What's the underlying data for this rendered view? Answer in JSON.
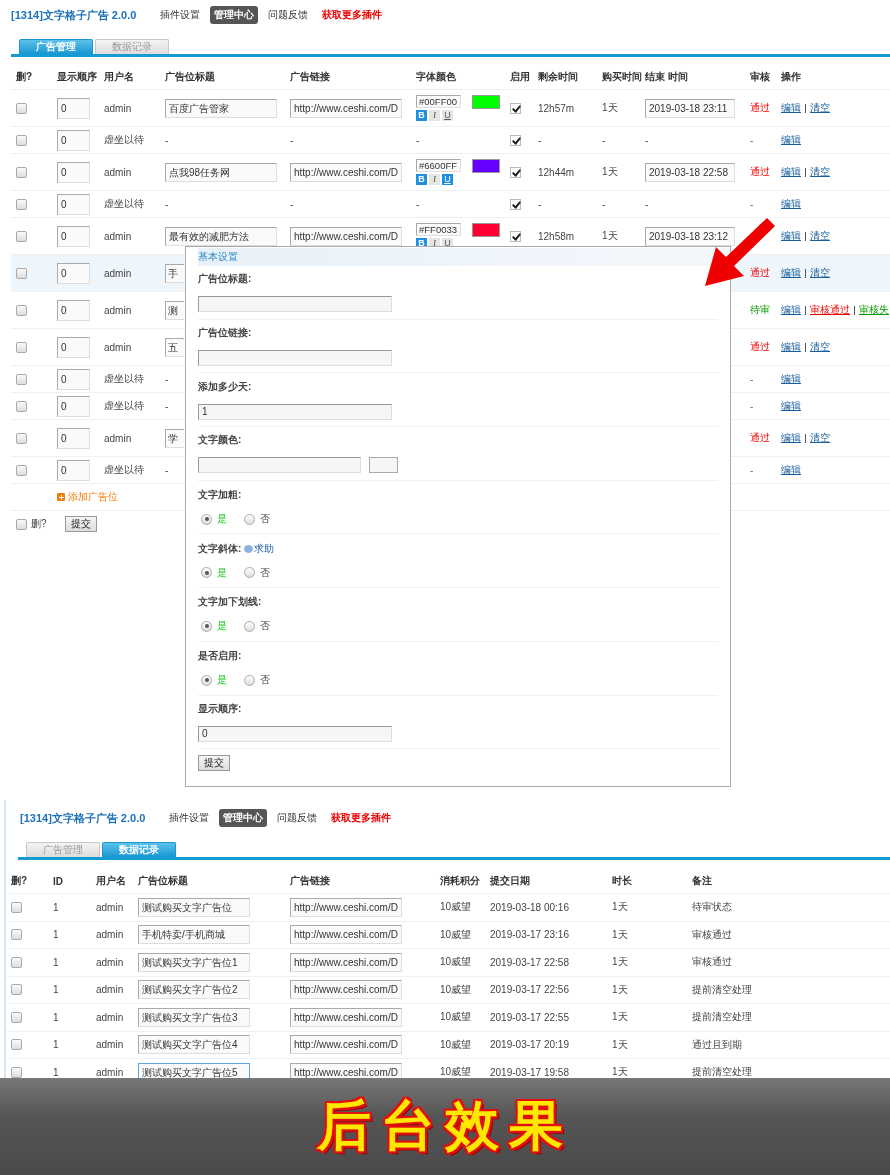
{
  "top": {
    "header": {
      "title": "[1314]文字格子广告 2.0.0",
      "nav": [
        {
          "label": "插件设置",
          "selected": false,
          "kind": "plain"
        },
        {
          "label": "管理中心",
          "selected": true,
          "kind": "plain"
        },
        {
          "label": "问题反馈",
          "selected": false,
          "kind": "plain"
        },
        {
          "label": "获取更多插件",
          "selected": false,
          "kind": "promo"
        }
      ]
    },
    "tabs": [
      {
        "label": "广告管理",
        "selected": true
      },
      {
        "label": "数据记录",
        "selected": false
      }
    ],
    "table": {
      "columns": [
        "删?",
        "显示顺序",
        "用户名",
        "广告位标题",
        "广告链接",
        "字体颜色",
        "启用",
        "剩余时间",
        "购买时间",
        "结束 时间",
        "审核",
        "操作"
      ],
      "rows": [
        {
          "kind": "ad",
          "selected": false,
          "delete": false,
          "order": "0",
          "user": "admin",
          "title": "百度广告管家",
          "link": "http://www.ceshi.com/D",
          "font_color": {
            "hex": "#00FF00",
            "format": [
              {
                "label": "B",
                "on": true
              },
              {
                "label": "I",
                "on": false
              },
              {
                "label": "U",
                "on": false
              }
            ]
          },
          "enabled": true,
          "remaining": "12h57m",
          "bought": "1天",
          "end": "2019-03-18 23:11",
          "status": {
            "text": "通过",
            "kind": "pass"
          },
          "actions": [
            {
              "label": "编辑",
              "kind": "edit"
            },
            {
              "label": "清空",
              "kind": "clear"
            }
          ]
        },
        {
          "kind": "vacant",
          "selected": false,
          "delete": false,
          "order": "0",
          "user": "虚坐以待",
          "title": "-",
          "link": "-",
          "font_color_text": "-",
          "enabled": true,
          "remaining": "-",
          "bought": "-",
          "end": "-",
          "status": {
            "text": "-",
            "kind": "none"
          },
          "actions": [
            {
              "label": "编辑",
              "kind": "edit"
            }
          ]
        },
        {
          "kind": "ad",
          "selected": false,
          "delete": false,
          "order": "0",
          "user": "admin",
          "title": "点我98任务网",
          "link": "http://www.ceshi.com/D",
          "font_color": {
            "hex": "#6600FF",
            "format": [
              {
                "label": "B",
                "on": true
              },
              {
                "label": "I",
                "on": false
              },
              {
                "label": "U",
                "on": true
              }
            ]
          },
          "enabled": true,
          "remaining": "12h44m",
          "bought": "1天",
          "end": "2019-03-18 22:58",
          "status": {
            "text": "通过",
            "kind": "pass"
          },
          "actions": [
            {
              "label": "编辑",
              "kind": "edit"
            },
            {
              "label": "清空",
              "kind": "clear"
            }
          ]
        },
        {
          "kind": "vacant",
          "selected": false,
          "delete": false,
          "order": "0",
          "user": "虚坐以待",
          "title": "-",
          "link": "-",
          "font_color_text": "-",
          "enabled": true,
          "remaining": "-",
          "bought": "-",
          "end": "-",
          "status": {
            "text": "-",
            "kind": "none"
          },
          "actions": [
            {
              "label": "编辑",
              "kind": "edit"
            }
          ]
        },
        {
          "kind": "ad",
          "selected": false,
          "delete": false,
          "order": "0",
          "user": "admin",
          "title": "最有效的减肥方法",
          "link": "http://www.ceshi.com/D",
          "font_color": {
            "hex": "#FF0033",
            "format": [
              {
                "label": "B",
                "on": true
              },
              {
                "label": "I",
                "on": false
              },
              {
                "label": "U",
                "on": false
              }
            ]
          },
          "enabled": true,
          "remaining": "12h58m",
          "bought": "1天",
          "end": "2019-03-18 23:12",
          "actions": [
            {
              "label": "编辑",
              "kind": "edit"
            },
            {
              "label": "清空",
              "kind": "clear"
            }
          ]
        },
        {
          "kind": "ad",
          "selected": true,
          "delete": false,
          "order": "0",
          "user": "admin",
          "title": "手",
          "status": {
            "text": "通过",
            "kind": "pass"
          },
          "actions": [
            {
              "label": "编辑",
              "kind": "edit"
            },
            {
              "label": "清空",
              "kind": "clear"
            }
          ]
        },
        {
          "kind": "ad",
          "selected": false,
          "delete": false,
          "order": "0",
          "user": "admin",
          "title": "测",
          "status": {
            "text": "待审",
            "kind": "pending"
          },
          "actions": [
            {
              "label": "编辑",
              "kind": "edit"
            },
            {
              "label": "审核通过",
              "kind": "approve"
            },
            {
              "label": "审核失",
              "kind": "reject"
            }
          ]
        },
        {
          "kind": "ad",
          "selected": false,
          "delete": false,
          "order": "0",
          "user": "admin",
          "title": "五",
          "status": {
            "text": "通过",
            "kind": "pass"
          },
          "actions": [
            {
              "label": "编辑",
              "kind": "edit"
            },
            {
              "label": "清空",
              "kind": "clear"
            }
          ]
        },
        {
          "kind": "vacant",
          "selected": false,
          "delete": false,
          "order": "0",
          "user": "虚坐以待",
          "title": "-",
          "status": {
            "text": "-",
            "kind": "none"
          },
          "actions": [
            {
              "label": "编辑",
              "kind": "edit"
            }
          ]
        },
        {
          "kind": "vacant",
          "selected": false,
          "delete": false,
          "order": "0",
          "user": "虚坐以待",
          "title": "-",
          "status": {
            "text": "-",
            "kind": "none"
          },
          "actions": [
            {
              "label": "编辑",
              "kind": "edit"
            }
          ]
        },
        {
          "kind": "ad",
          "selected": false,
          "delete": false,
          "order": "0",
          "user": "admin",
          "title": "学",
          "status": {
            "text": "通过",
            "kind": "pass"
          },
          "actions": [
            {
              "label": "编辑",
              "kind": "edit"
            },
            {
              "label": "清空",
              "kind": "clear"
            }
          ]
        },
        {
          "kind": "vacant",
          "selected": false,
          "delete": false,
          "order": "0",
          "user": "虚坐以待",
          "title": "-",
          "status": {
            "text": "-",
            "kind": "none"
          },
          "actions": [
            {
              "label": "编辑",
              "kind": "edit"
            }
          ]
        }
      ],
      "add_link": "添加广告位",
      "footer": {
        "delete_label": "删?",
        "delete": false,
        "submit": "提交"
      }
    },
    "dialog": {
      "title": "基本设置",
      "fields": [
        {
          "kind": "text",
          "label": "广告位标题:"
        },
        {
          "kind": "text",
          "label": "广告位链接:"
        },
        {
          "kind": "text",
          "label": "添加多少天:",
          "value": "1"
        },
        {
          "kind": "color",
          "label": "文字颜色:"
        },
        {
          "kind": "radio",
          "label": "文字加粗:",
          "options": [
            {
              "label": "是",
              "selected": true
            },
            {
              "label": "否",
              "selected": false
            }
          ]
        },
        {
          "kind": "radio",
          "label": "文字斜体:",
          "help": "求助",
          "options": [
            {
              "label": "是",
              "selected": true
            },
            {
              "label": "否",
              "selected": false
            }
          ]
        },
        {
          "kind": "radio",
          "label": "文字加下划线:",
          "options": [
            {
              "label": "是",
              "selected": true
            },
            {
              "label": "否",
              "selected": false
            }
          ]
        },
        {
          "kind": "radio",
          "label": "是否启用:",
          "options": [
            {
              "label": "是",
              "selected": true
            },
            {
              "label": "否",
              "selected": false
            }
          ]
        },
        {
          "kind": "text",
          "label": "显示顺序:",
          "value": "0"
        }
      ],
      "submit": "提交"
    }
  },
  "bottom": {
    "header": {
      "title": "[1314]文字格子广告 2.0.0",
      "nav": [
        {
          "label": "插件设置",
          "selected": false,
          "kind": "plain"
        },
        {
          "label": "管理中心",
          "selected": true,
          "kind": "plain"
        },
        {
          "label": "问题反馈",
          "selected": false,
          "kind": "plain"
        },
        {
          "label": "获取更多插件",
          "selected": false,
          "kind": "promo"
        }
      ]
    },
    "tabs": [
      {
        "label": "广告管理",
        "selected": false
      },
      {
        "label": "数据记录",
        "selected": true
      }
    ],
    "table": {
      "columns": [
        "删?",
        "ID",
        "用户名",
        "广告位标题",
        "广告链接",
        "消耗积分",
        "提交日期",
        "时长",
        "备注"
      ],
      "rows": [
        {
          "delete": false,
          "id": "1",
          "user": "admin",
          "title": "测试购买文字广告位",
          "focused": false,
          "link": "http://www.ceshi.com/D",
          "cost": "10威望",
          "date": "2019-03-18 00:16",
          "duration": "1天",
          "note": "待审状态"
        },
        {
          "delete": false,
          "id": "1",
          "user": "admin",
          "title": "手机特卖/手机商城",
          "focused": false,
          "link": "http://www.ceshi.com/D",
          "cost": "10威望",
          "date": "2019-03-17 23:16",
          "duration": "1天",
          "note": "审核通过"
        },
        {
          "delete": false,
          "id": "1",
          "user": "admin",
          "title": "测试购买文字广告位1",
          "focused": false,
          "link": "http://www.ceshi.com/D",
          "cost": "10威望",
          "date": "2019-03-17 22:58",
          "duration": "1天",
          "note": "审核通过"
        },
        {
          "delete": false,
          "id": "1",
          "user": "admin",
          "title": "测试购买文字广告位2",
          "focused": false,
          "link": "http://www.ceshi.com/D",
          "cost": "10威望",
          "date": "2019-03-17 22:56",
          "duration": "1天",
          "note": "提前清空处理"
        },
        {
          "delete": false,
          "id": "1",
          "user": "admin",
          "title": "测试购买文字广告位3",
          "focused": false,
          "link": "http://www.ceshi.com/D",
          "cost": "10威望",
          "date": "2019-03-17 22:55",
          "duration": "1天",
          "note": "提前清空处理"
        },
        {
          "delete": false,
          "id": "1",
          "user": "admin",
          "title": "测试购买文字广告位4",
          "focused": false,
          "link": "http://www.ceshi.com/D",
          "cost": "10威望",
          "date": "2019-03-17 20:19",
          "duration": "1天",
          "note": "通过且到期"
        },
        {
          "delete": false,
          "id": "1",
          "user": "admin",
          "title": "测试购买文字广告位5",
          "focused": true,
          "link": "http://www.ceshi.com/D",
          "cost": "10威望",
          "date": "2019-03-17 19:58",
          "duration": "1天",
          "note": "提前清空处理"
        }
      ]
    }
  },
  "banner": {
    "text": "后台效果"
  }
}
